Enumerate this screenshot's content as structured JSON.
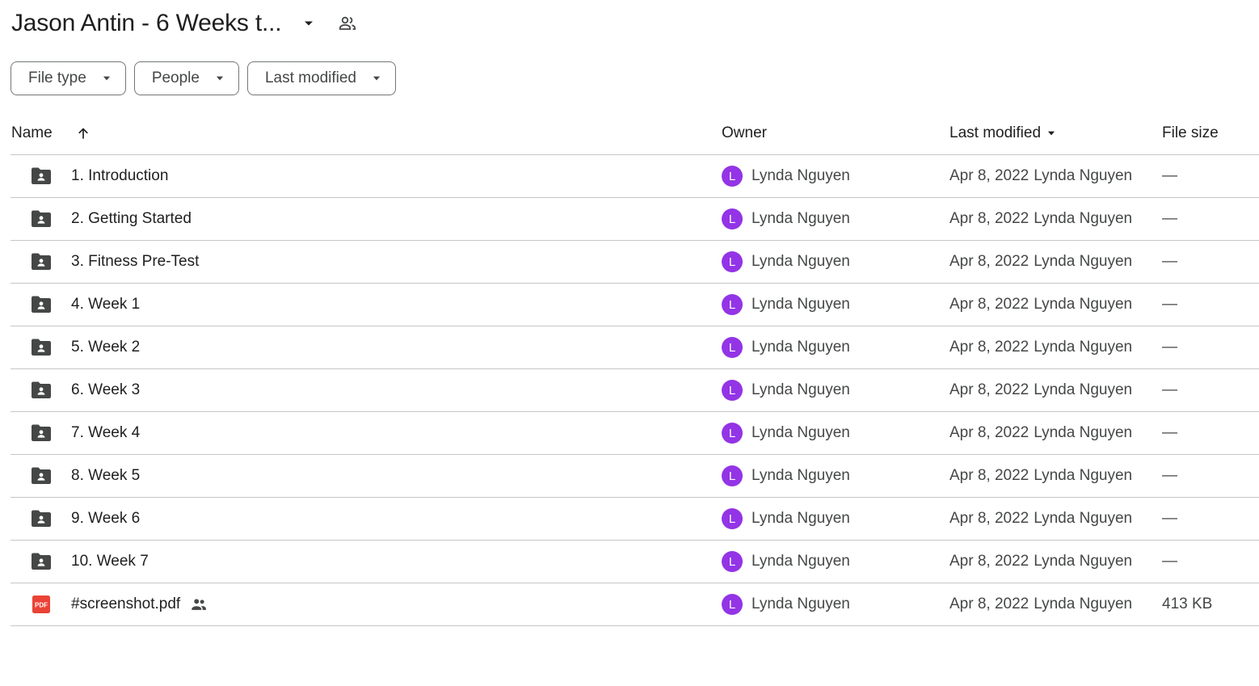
{
  "header": {
    "title": "Jason Antin - 6 Weeks t...",
    "title_caret_icon": "arrow-drop-down-icon",
    "shared_icon": "people-outline-icon"
  },
  "filters": [
    {
      "label": "File type"
    },
    {
      "label": "People"
    },
    {
      "label": "Last modified"
    }
  ],
  "columns": {
    "name": "Name",
    "owner": "Owner",
    "last_modified": "Last modified",
    "file_size": "File size",
    "sort_icon": "arrow-upward-icon"
  },
  "rows": [
    {
      "name": "1. Introduction",
      "type": "shared-folder",
      "owner": "Lynda Nguyen",
      "owner_initial": "L",
      "modified_date": "Apr 8, 2022",
      "modified_by": "Lynda Nguyen",
      "size": "—"
    },
    {
      "name": "2. Getting Started",
      "type": "shared-folder",
      "owner": "Lynda Nguyen",
      "owner_initial": "L",
      "modified_date": "Apr 8, 2022",
      "modified_by": "Lynda Nguyen",
      "size": "—"
    },
    {
      "name": "3. Fitness Pre-Test",
      "type": "shared-folder",
      "owner": "Lynda Nguyen",
      "owner_initial": "L",
      "modified_date": "Apr 8, 2022",
      "modified_by": "Lynda Nguyen",
      "size": "—"
    },
    {
      "name": "4. Week 1",
      "type": "shared-folder",
      "owner": "Lynda Nguyen",
      "owner_initial": "L",
      "modified_date": "Apr 8, 2022",
      "modified_by": "Lynda Nguyen",
      "size": "—"
    },
    {
      "name": "5. Week 2",
      "type": "shared-folder",
      "owner": "Lynda Nguyen",
      "owner_initial": "L",
      "modified_date": "Apr 8, 2022",
      "modified_by": "Lynda Nguyen",
      "size": "—"
    },
    {
      "name": "6. Week 3",
      "type": "shared-folder",
      "owner": "Lynda Nguyen",
      "owner_initial": "L",
      "modified_date": "Apr 8, 2022",
      "modified_by": "Lynda Nguyen",
      "size": "—"
    },
    {
      "name": "7. Week 4",
      "type": "shared-folder",
      "owner": "Lynda Nguyen",
      "owner_initial": "L",
      "modified_date": "Apr 8, 2022",
      "modified_by": "Lynda Nguyen",
      "size": "—"
    },
    {
      "name": "8. Week 5",
      "type": "shared-folder",
      "owner": "Lynda Nguyen",
      "owner_initial": "L",
      "modified_date": "Apr 8, 2022",
      "modified_by": "Lynda Nguyen",
      "size": "—"
    },
    {
      "name": "9. Week 6",
      "type": "shared-folder",
      "owner": "Lynda Nguyen",
      "owner_initial": "L",
      "modified_date": "Apr 8, 2022",
      "modified_by": "Lynda Nguyen",
      "size": "—"
    },
    {
      "name": "10. Week 7",
      "type": "shared-folder",
      "owner": "Lynda Nguyen",
      "owner_initial": "L",
      "modified_date": "Apr 8, 2022",
      "modified_by": "Lynda Nguyen",
      "size": "—"
    },
    {
      "name": "#screenshot.pdf",
      "type": "pdf",
      "shared": true,
      "owner": "Lynda Nguyen",
      "owner_initial": "L",
      "modified_date": "Apr 8, 2022",
      "modified_by": "Lynda Nguyen",
      "size": "413 KB"
    }
  ],
  "icons": {
    "pdf_label": "PDF"
  },
  "colors": {
    "avatar": "#9334e6",
    "pdf": "#ea4335",
    "folder": "#444746",
    "divider": "#c4c7c5"
  }
}
